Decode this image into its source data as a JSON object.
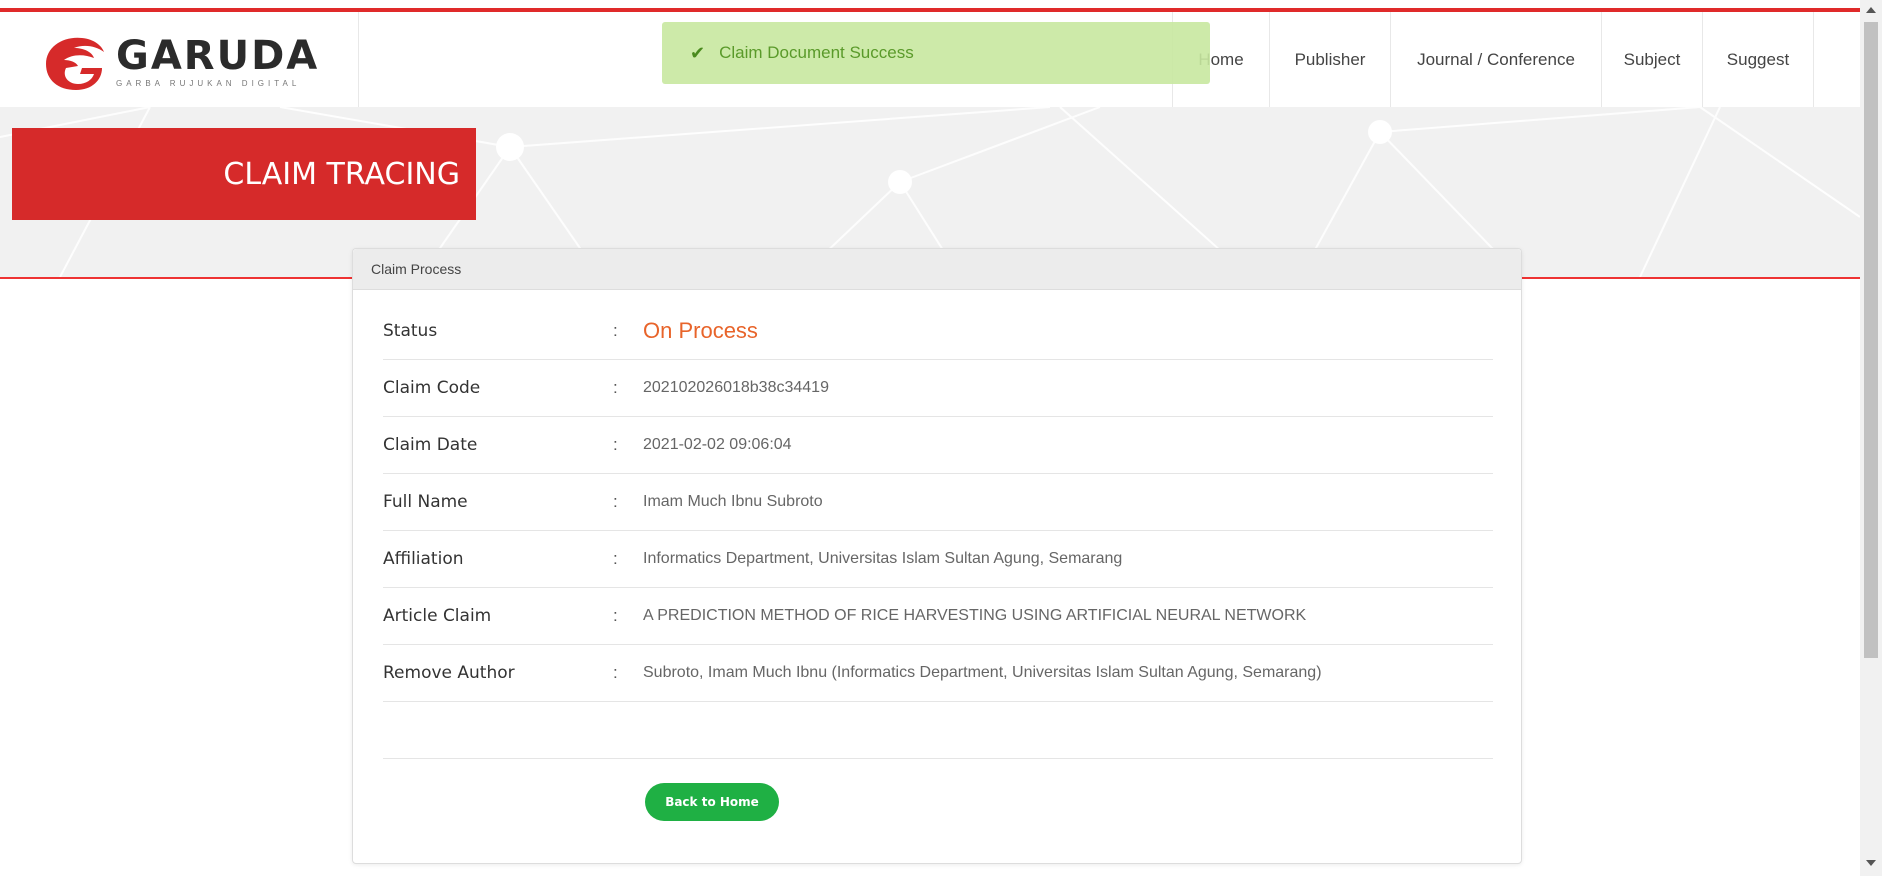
{
  "brand": {
    "name": "GARUDA",
    "tagline": "GARBA RUJUKAN DIGITAL",
    "accent": "#d62a2a"
  },
  "toast": {
    "message": "Claim Document Success",
    "icon": "check-icon"
  },
  "nav": {
    "items": [
      "Home",
      "Publisher",
      "Journal / Conference",
      "Subject",
      "Suggest"
    ]
  },
  "page": {
    "title": "CLAIM TRACING"
  },
  "claim": {
    "header": "Claim Process",
    "rows": [
      {
        "label": "Status",
        "value": "On Process"
      },
      {
        "label": "Claim Code",
        "value": "202102026018b38c34419"
      },
      {
        "label": "Claim Date",
        "value": "2021-02-02 09:06:04"
      },
      {
        "label": "Full Name",
        "value": "Imam Much Ibnu Subroto"
      },
      {
        "label": "Affiliation",
        "value": "Informatics Department, Universitas Islam Sultan Agung, Semarang"
      },
      {
        "label": "Article Claim",
        "value": "A PREDICTION METHOD OF RICE HARVESTING USING ARTIFICIAL NEURAL NETWORK"
      },
      {
        "label": "Remove Author",
        "value": "Subroto, Imam Much Ibnu (Informatics Department, Universitas Islam Sultan Agung, Semarang)"
      }
    ],
    "colon": ":",
    "back_label": "Back to Home"
  }
}
